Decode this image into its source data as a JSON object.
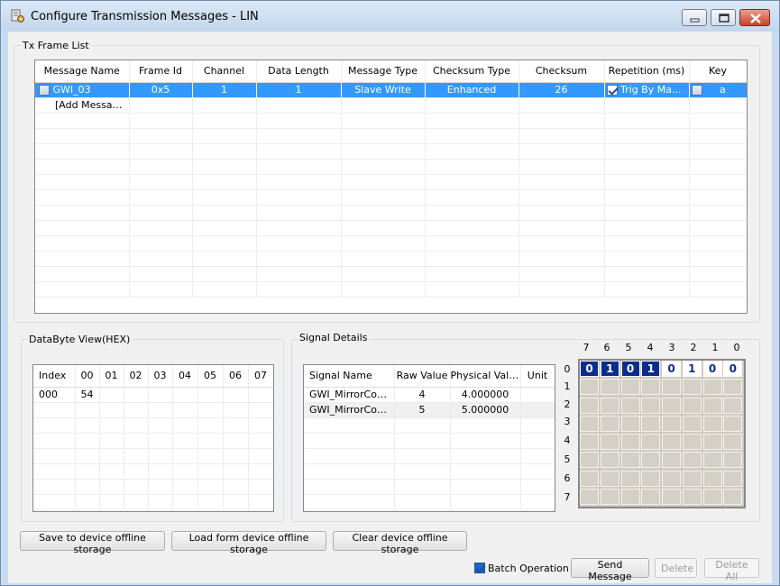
{
  "window": {
    "title": "Configure Transmission Messages - LIN"
  },
  "tx_frame_list": {
    "label": "Tx Frame List",
    "columns": [
      "Message Name",
      "Frame Id",
      "Channel",
      "Data Length",
      "Message Type",
      "Checksum Type",
      "Checksum",
      "Repetition (ms)",
      "Key"
    ],
    "rows": [
      {
        "name": "GWI_03",
        "frame_id": "0x5",
        "channel": "1",
        "data_length": "1",
        "message_type": "Slave Write",
        "checksum_type": "Enhanced",
        "checksum": "26",
        "repetition": "Trig By Ma...",
        "key": "a",
        "enabled": false,
        "repetition_checked": true,
        "key_checked": false
      }
    ],
    "add_message": "[Add Message]"
  },
  "databyte_view": {
    "label": "DataByte View(HEX)",
    "columns": [
      "Index",
      "00",
      "01",
      "02",
      "03",
      "04",
      "05",
      "06",
      "07"
    ],
    "rows": [
      [
        "000",
        "54",
        "",
        "",
        "",
        "",
        "",
        "",
        ""
      ]
    ]
  },
  "signal_details": {
    "label": "Signal Details",
    "columns": [
      "Signal Name",
      "Raw Value",
      "Physical Value",
      "Unit"
    ],
    "rows": [
      {
        "name": "GWI_MirrorCom...",
        "raw": "4",
        "physical": "4.000000",
        "unit": ""
      },
      {
        "name": "GWI_MirrorCom...",
        "raw": "5",
        "physical": "5.000000",
        "unit": ""
      }
    ],
    "bit_columns": [
      "7",
      "6",
      "5",
      "4",
      "3",
      "2",
      "1",
      "0"
    ],
    "bit_rows": [
      "0",
      "1",
      "2",
      "3",
      "4",
      "5",
      "6",
      "7"
    ],
    "byte0_bits": [
      "0",
      "1",
      "0",
      "1",
      "0",
      "1",
      "0",
      "0"
    ],
    "byte0_highlight": [
      true,
      true,
      true,
      true,
      false,
      false,
      false,
      false
    ]
  },
  "buttons": {
    "save": "Save to device offline storage",
    "load": "Load form device offline storage",
    "clear": "Clear device offline storage",
    "batch": "Batch Operation",
    "send": "Send Message",
    "delete": "Delete",
    "delete_all": "Delete All"
  },
  "batch_checked": true,
  "icons": {
    "app": "settings-icon",
    "minimize": "minimize-icon",
    "maximize": "maximize-icon",
    "close": "close-icon"
  }
}
